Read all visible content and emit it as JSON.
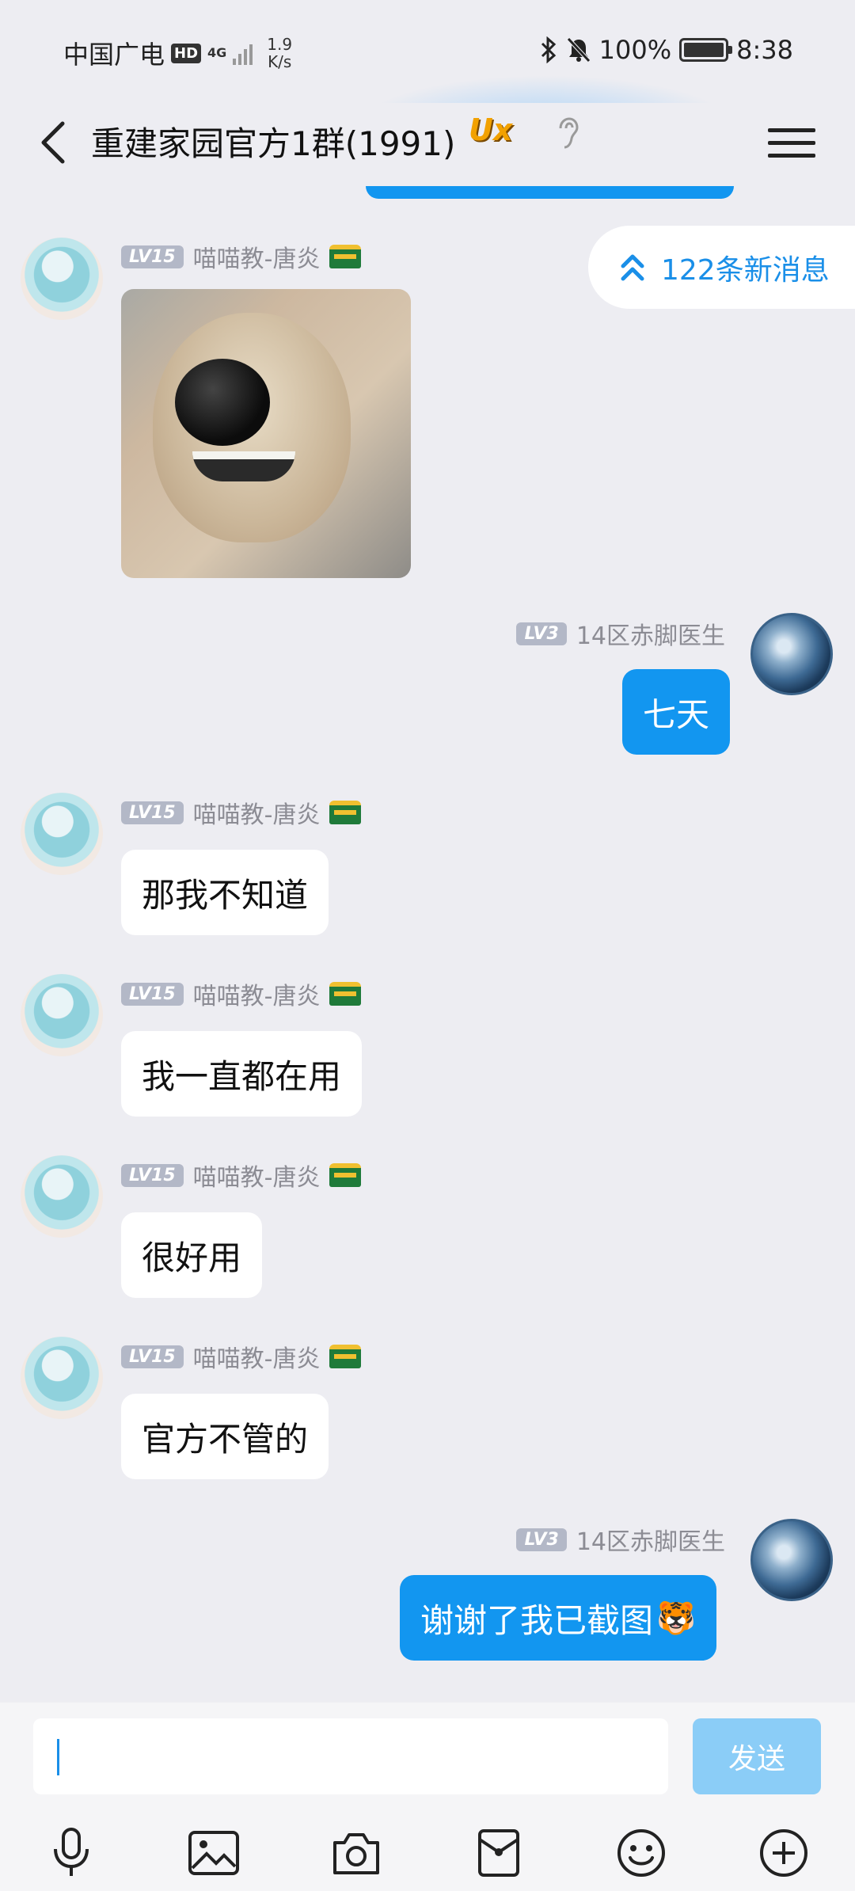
{
  "status_bar": {
    "carrier": "中国广电",
    "hd": "HD",
    "network": "4G",
    "speed_value": "1.9",
    "speed_unit": "K/s",
    "battery": "100%",
    "time": "8:38"
  },
  "header": {
    "title": "重建家园官方1群(1991)",
    "badge": "Ux"
  },
  "new_messages": "122条新消息",
  "messages": [
    {
      "kind": "image",
      "level": "LV15",
      "sender": "喵喵教-唐炎",
      "direction": "in"
    },
    {
      "kind": "text",
      "level": "LV3",
      "sender": "14区赤脚医生",
      "text": "七天",
      "direction": "out"
    },
    {
      "kind": "text",
      "level": "LV15",
      "sender": "喵喵教-唐炎",
      "text": "那我不知道",
      "direction": "in"
    },
    {
      "kind": "text",
      "level": "LV15",
      "sender": "喵喵教-唐炎",
      "text": "我一直都在用",
      "direction": "in"
    },
    {
      "kind": "text",
      "level": "LV15",
      "sender": "喵喵教-唐炎",
      "text": "很好用",
      "direction": "in"
    },
    {
      "kind": "text",
      "level": "LV15",
      "sender": "喵喵教-唐炎",
      "text": "官方不管的",
      "direction": "in"
    },
    {
      "kind": "text",
      "level": "LV3",
      "sender": "14区赤脚医生",
      "text": "谢谢了我已截图",
      "emoji": "🐯",
      "direction": "out"
    }
  ],
  "input": {
    "value": "",
    "send_label": "发送"
  },
  "toolbar": {
    "icons": [
      "microphone-icon",
      "image-icon",
      "camera-icon",
      "red-packet-icon",
      "emoji-icon",
      "plus-icon"
    ]
  },
  "colors": {
    "background": "#ededf2",
    "accent": "#1296f0",
    "send_disabled": "#8bcdf7"
  }
}
